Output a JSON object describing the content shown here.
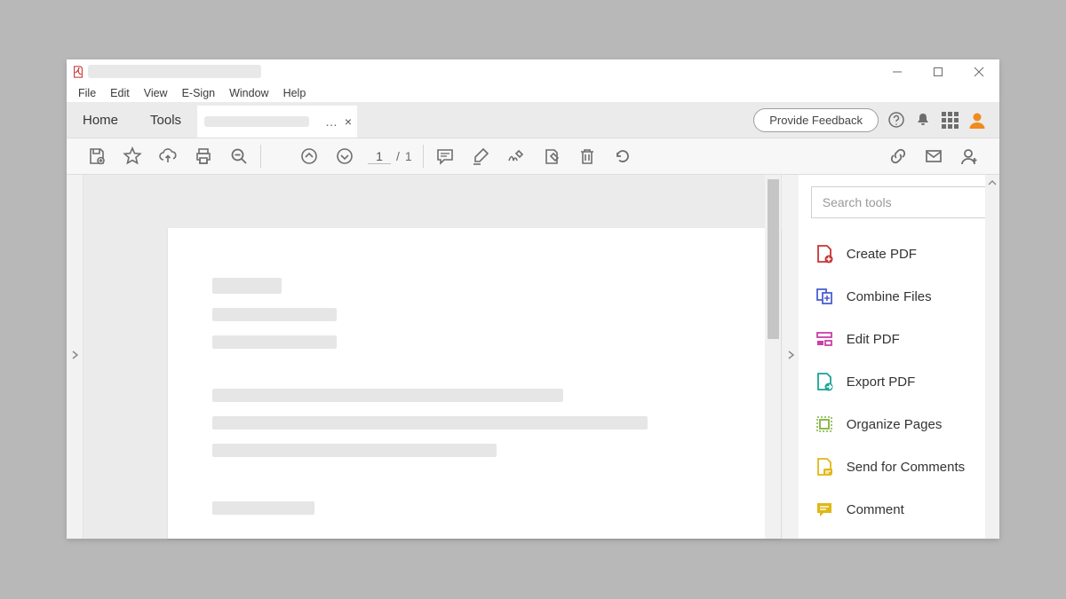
{
  "menubar": [
    "File",
    "Edit",
    "View",
    "E-Sign",
    "Window",
    "Help"
  ],
  "tabs": {
    "home": "Home",
    "tools": "Tools",
    "doc_ellipsis": "…",
    "doc_close": "×"
  },
  "feedback": "Provide Feedback",
  "page": {
    "current": "1",
    "sep": "/",
    "total": "1"
  },
  "search_placeholder": "Search tools",
  "tools_list": [
    {
      "label": "Create PDF"
    },
    {
      "label": "Combine Files"
    },
    {
      "label": "Edit PDF"
    },
    {
      "label": "Export PDF"
    },
    {
      "label": "Organize Pages"
    },
    {
      "label": "Send for Comments"
    },
    {
      "label": "Comment"
    }
  ]
}
